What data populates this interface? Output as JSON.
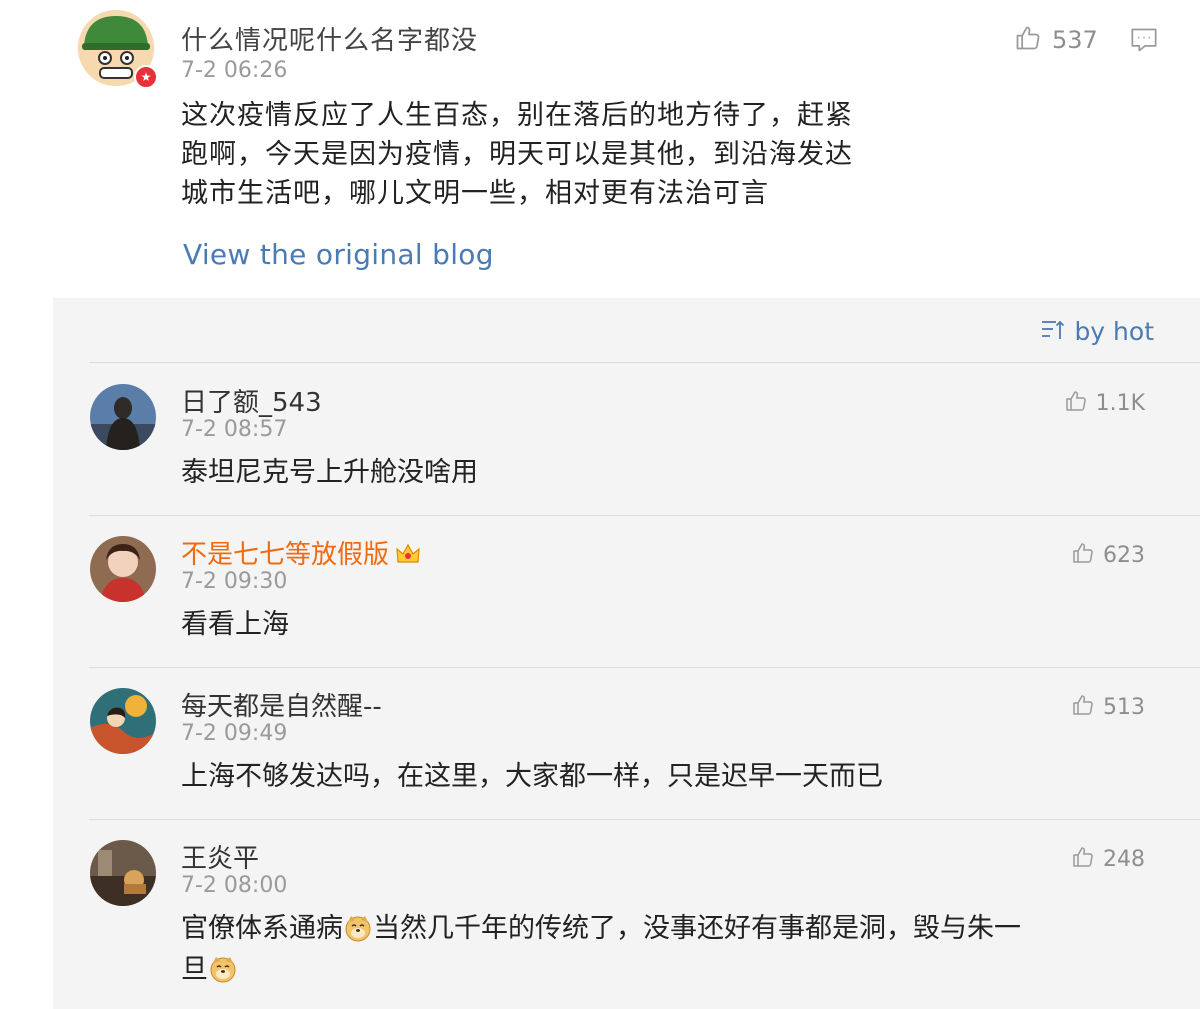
{
  "post": {
    "author": "什么情况呢什么名字都没",
    "time": "7-2 06:26",
    "body_lines": [
      "这次疫情反应了人生百态，别在落后的地方待了，赶紧",
      "跑啊，今天是因为疫情，明天可以是其他，到沿海发达",
      "城市生活吧，哪儿文明一些，相对更有法治可言"
    ],
    "like_count": "537",
    "link_label": "View the original blog",
    "avatar_icon": "helmet-cartoon-avatar",
    "badge_icon": "verified-badge-icon"
  },
  "comments_panel": {
    "sort_label": "by hot",
    "sort_icon": "sort-icon"
  },
  "comments": [
    {
      "author": "日了额_543",
      "time": "7-2 08:57",
      "text": "泰坦尼克号上升舱没啥用",
      "likes": "1.1K"
    },
    {
      "author": "不是七七等放假版",
      "time": "7-2 09:30",
      "text": "看看上海",
      "likes": "623",
      "vip": true,
      "badge_icon": "crown-icon"
    },
    {
      "author": "每天都是自然醒--",
      "time": "7-2 09:49",
      "text": "上海不够发达吗，在这里，大家都一样，只是迟早一天而已",
      "likes": "513"
    },
    {
      "author": "王炎平",
      "time": "7-2 08:00",
      "text_part1": "官僚体系通病",
      "text_part2": "当然几千年的传统了，没事还好有事都是洞，毁与朱一",
      "text_part3": "旦",
      "emoji_icon": "doge-emoji",
      "likes": "248"
    }
  ],
  "colors": {
    "link": "#4a7bb2",
    "vip_name": "#f06a10",
    "panel_bg": "#f4f4f4",
    "muted": "#9a9a9a"
  }
}
